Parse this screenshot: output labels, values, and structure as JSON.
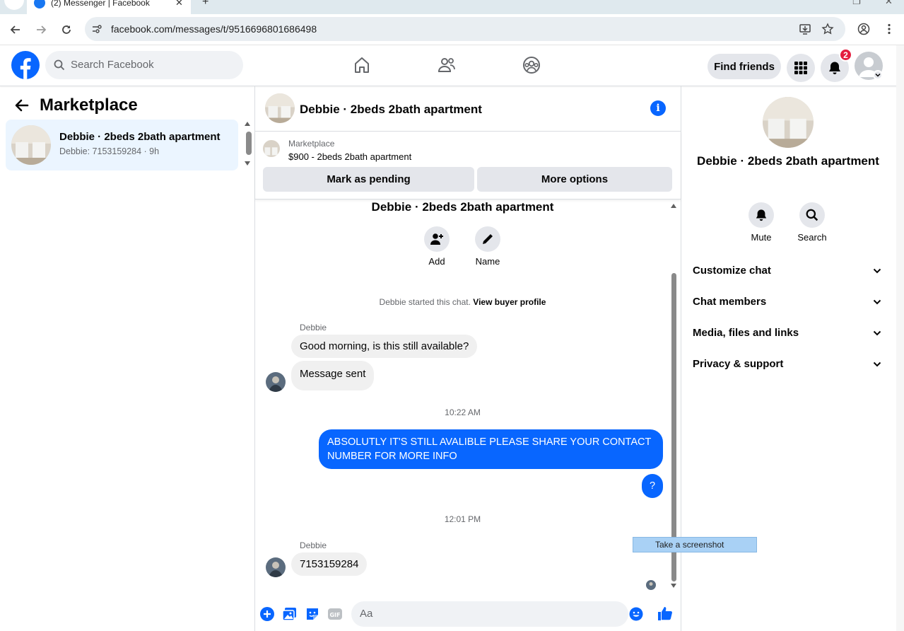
{
  "browser": {
    "tab_title": "(2) Messenger | Facebook",
    "url": "facebook.com/messages/t/9516696801686498"
  },
  "fb": {
    "search_placeholder": "Search Facebook",
    "find_friends": "Find friends",
    "notification_count": "2"
  },
  "left": {
    "title": "Marketplace",
    "conversations": [
      {
        "name": "Debbie · 2beds 2bath apartment",
        "preview": "Debbie: 7153159284 · 9h"
      }
    ]
  },
  "chat": {
    "header_name": "Debbie · 2beds 2bath apartment",
    "marketplace_label": "Marketplace",
    "listing": "$900 - 2beds 2bath apartment",
    "mark_pending": "Mark as pending",
    "more_options": "More options",
    "thread_title": "Debbie · 2beds 2bath apartment",
    "add_label": "Add",
    "name_label": "Name",
    "started_text": "Debbie started this chat.",
    "view_profile": "View buyer profile",
    "messages": [
      {
        "sender": "Debbie",
        "text": "Good morning, is this still available?"
      },
      {
        "text": "Message sent"
      },
      {
        "time": "10:22 AM"
      },
      {
        "text": "ABSOLUTLY IT'S STILL AVALIBLE PLEASE SHARE YOUR CONTACT NUMBER  FOR MORE INFO"
      },
      {
        "text": "?"
      },
      {
        "time": "12:01 PM"
      },
      {
        "sender": "Debbie",
        "text": "7153159284"
      }
    ],
    "composer_placeholder": "Aa",
    "tooltip": "Take a screenshot"
  },
  "right": {
    "name": "Debbie · 2beds 2bath apartment",
    "mute": "Mute",
    "search": "Search",
    "sections": [
      "Customize chat",
      "Chat members",
      "Media, files and links",
      "Privacy & support"
    ]
  },
  "colors": {
    "accent": "#0866ff",
    "selected_row": "#ebf5ff",
    "badge": "#e41e3f",
    "bubble_in": "#f0f0f0"
  }
}
